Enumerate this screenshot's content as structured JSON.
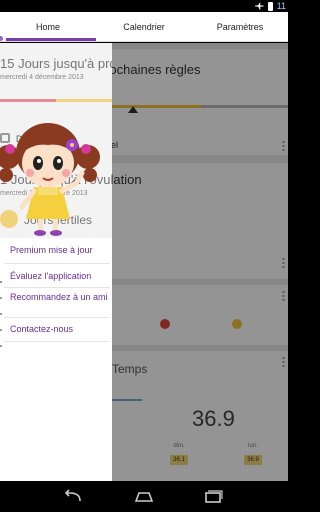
{
  "status_bar": {
    "clock": "11"
  },
  "tabs": [
    {
      "label": "Home",
      "active": true
    },
    {
      "label": "Calendrier",
      "active": false
    },
    {
      "label": "Paramètres",
      "active": false
    }
  ],
  "period_card": {
    "title": "15 Jours jusqu'à prochaines règles",
    "date": "mercredi 4 décembre 2013",
    "cycle_label": "Durée du cycle menstruel"
  },
  "ovulation_card": {
    "title": "1 Jour jusqu'à l'ovulation",
    "date": "mercredi 20 novembre 2013",
    "fertile_label": "Jours fertiles"
  },
  "temperature_card": {
    "title": "Temps",
    "value": "36.9",
    "days": [
      {
        "label": "dim.",
        "value": "36.1"
      },
      {
        "label": "lun.",
        "value": "36.9"
      }
    ]
  },
  "drawer": {
    "items": [
      {
        "label": "Premium mise à jour"
      },
      {
        "label": "Évaluez l'application"
      },
      {
        "label": "Recommandez à un ami"
      },
      {
        "label": "Contactez-nous"
      }
    ]
  },
  "colors": {
    "accent": "#7b3ea8",
    "period": "#e65a6a",
    "fertile": "#f2c33b"
  }
}
